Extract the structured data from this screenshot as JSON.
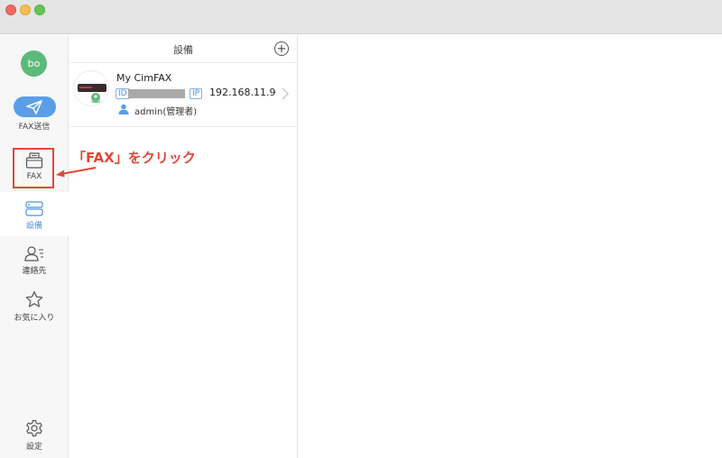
{
  "window": {
    "traffic_lights": [
      "close",
      "minimize",
      "zoom"
    ]
  },
  "sidebar": {
    "avatar_text": "bo",
    "items": [
      {
        "key": "send",
        "label": "FAX送信",
        "icon": "paper-plane-icon"
      },
      {
        "key": "fax",
        "label": "FAX",
        "icon": "fax-tray-icon"
      },
      {
        "key": "devices",
        "label": "設備",
        "icon": "device-icon",
        "active": true
      },
      {
        "key": "contacts",
        "label": "連絡先",
        "icon": "contact-icon"
      },
      {
        "key": "favorites",
        "label": "お気に入り",
        "icon": "star-icon"
      },
      {
        "key": "settings",
        "label": "設定",
        "icon": "gear-icon"
      }
    ]
  },
  "panel": {
    "title": "設備",
    "add_label": "+",
    "devices": [
      {
        "name": "My CimFAX",
        "id_tag": "ID",
        "ip_tag": "IP",
        "ip": "192.168.11.9",
        "user": "admin(管理者)"
      }
    ]
  },
  "annotation": {
    "text": "「FAX」をクリック",
    "color": "#e04836"
  },
  "colors": {
    "accent": "#4a90e2",
    "send_button": "#5b9ee8",
    "avatar": "#5cb97a",
    "highlight": "#e04836"
  }
}
